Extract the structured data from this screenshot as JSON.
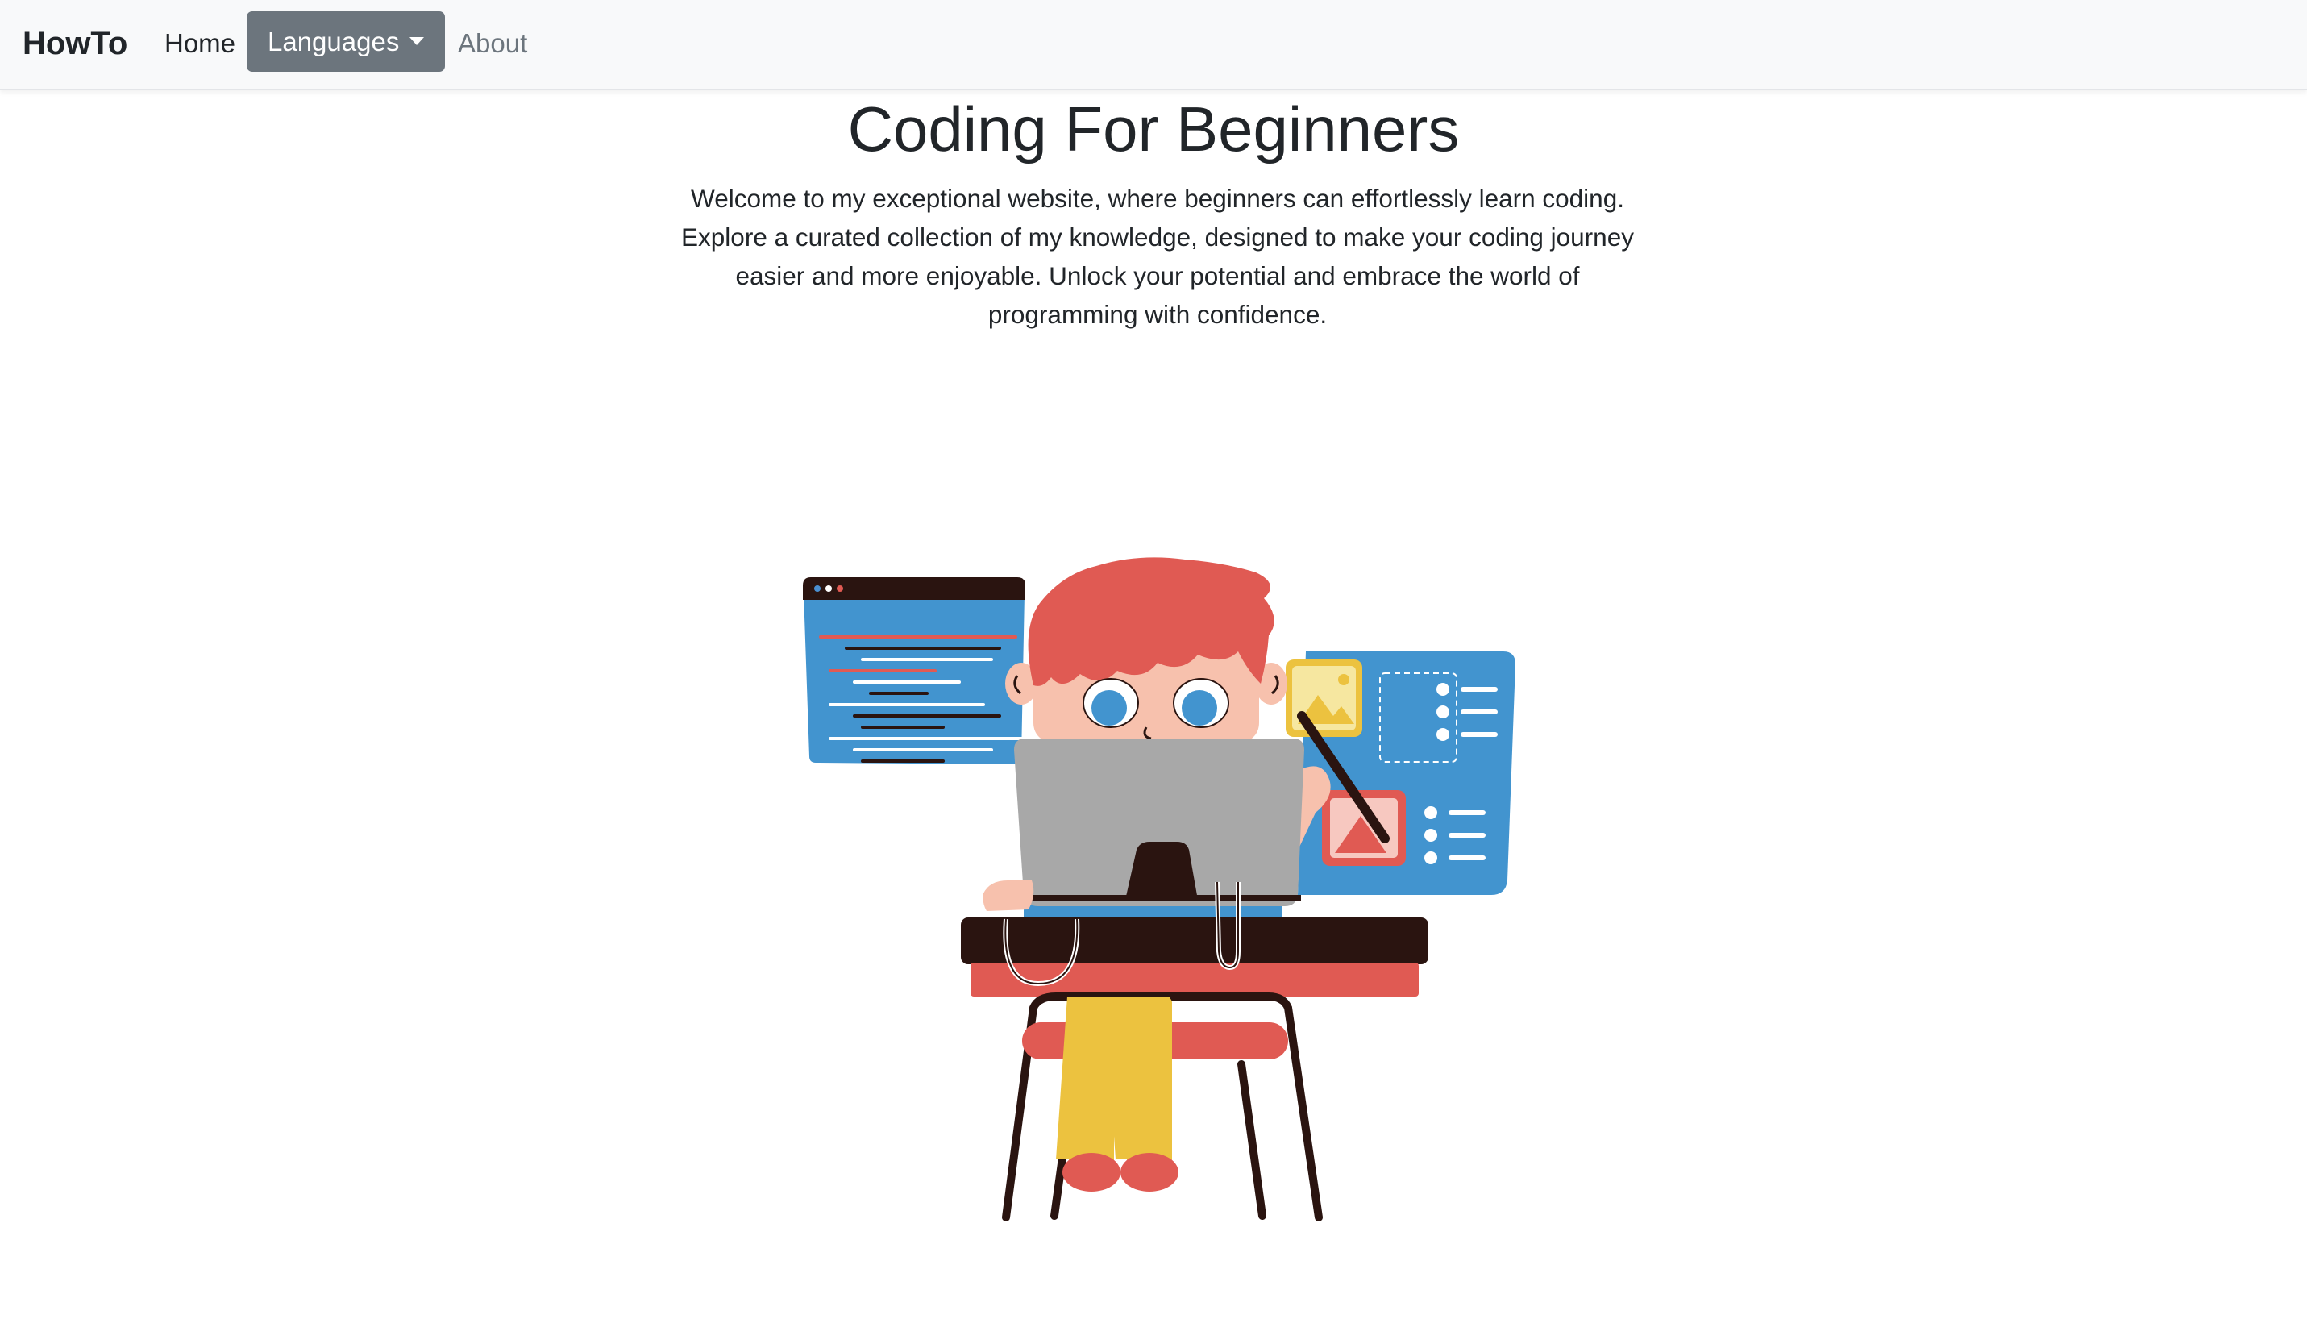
{
  "navbar": {
    "brand": "HowTo",
    "items": [
      {
        "label": "Home"
      },
      {
        "label": "Languages",
        "type": "dropdown",
        "active": true
      },
      {
        "label": "About"
      }
    ]
  },
  "hero": {
    "title": "Coding For Beginners",
    "description": "Welcome to my exceptional website, where beginners can effortlessly learn coding. Explore a curated collection of my knowledge, designed to make your coding journey easier and more enjoyable. Unlock your potential and embrace the world of programming with confidence."
  },
  "illustration": {
    "subject": "person-coding-at-desk",
    "colors": {
      "hair": "#e05a53",
      "panel_blue": "#4294cf",
      "laptop": "#a8a8a8",
      "dark": "#2a1410",
      "pants": "#ecc23f",
      "desk_top": "#e05a53"
    }
  }
}
